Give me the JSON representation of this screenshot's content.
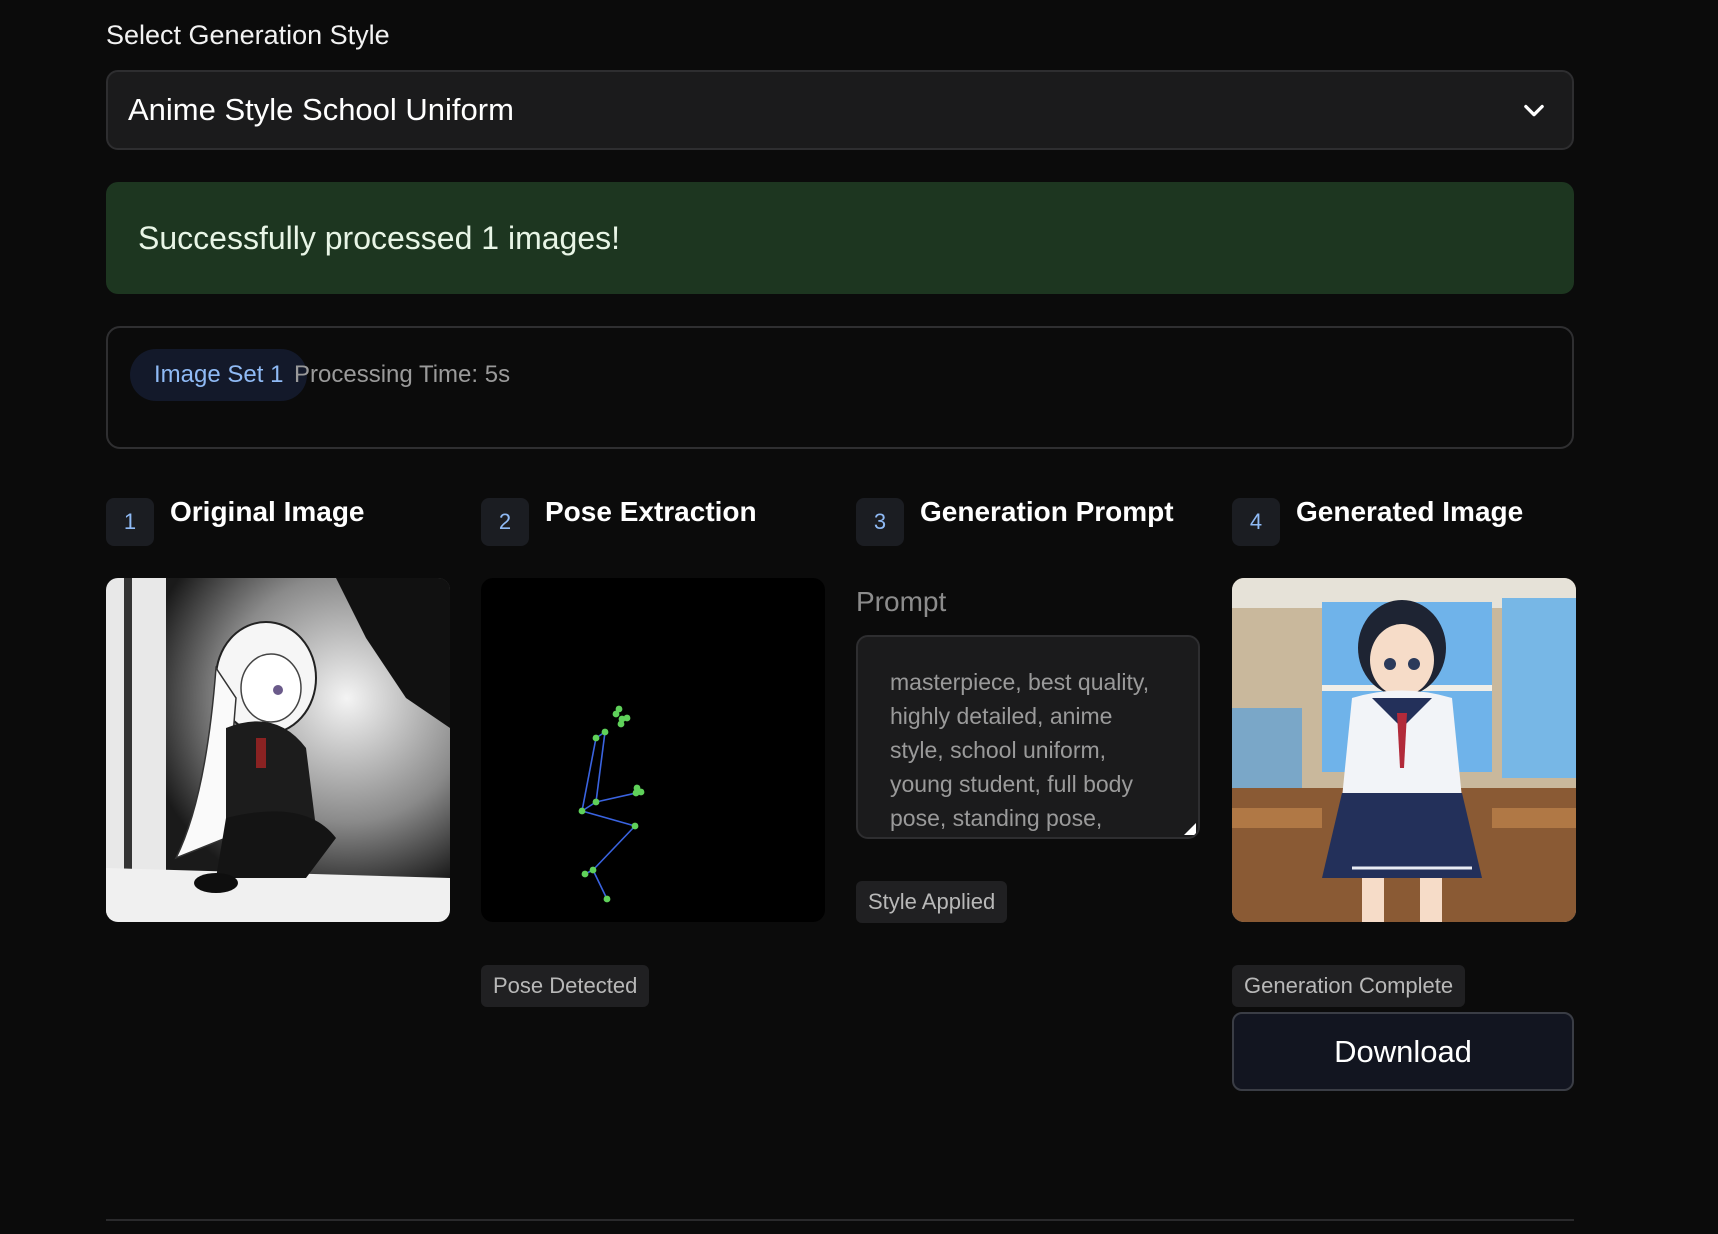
{
  "style_selector": {
    "label": "Select Generation Style",
    "selected": "Anime Style School Uniform"
  },
  "status": {
    "message": "Successfully processed 1 images!"
  },
  "image_set": {
    "name": "Image Set 1",
    "processing_time": "Processing Time: 5s"
  },
  "steps": [
    {
      "number": "1",
      "title": "Original Image"
    },
    {
      "number": "2",
      "title": "Pose Extraction",
      "tag": "Pose Detected"
    },
    {
      "number": "3",
      "title": "Generation Prompt",
      "prompt_label": "Prompt",
      "prompt_value": "masterpiece, best quality, highly detailed, anime style, school uniform, young student, full body pose, standing pose,",
      "tag": "Style Applied"
    },
    {
      "number": "4",
      "title": "Generated Image",
      "tag": "Generation Complete",
      "download_label": "Download"
    }
  ],
  "colors": {
    "background": "#0b0b0b",
    "success_bg": "#1d3620",
    "accent_blue": "#8fbaf5",
    "pose_joint": "#5fd15a",
    "pose_limb": "#3a63e0"
  },
  "icons": {
    "dropdown": "chevron-down-icon",
    "resize": "resize-handle-icon"
  }
}
